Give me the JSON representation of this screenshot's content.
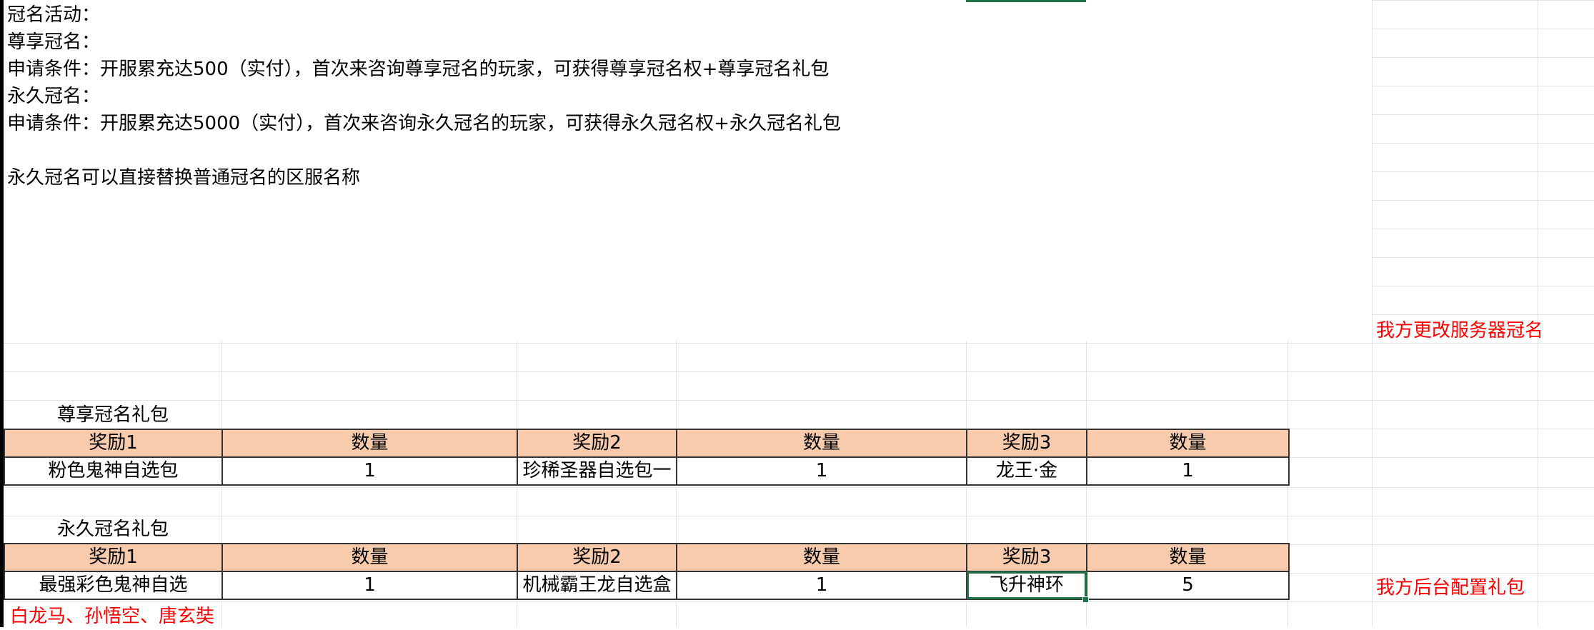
{
  "intro": {
    "line1": "冠名活动：",
    "line2": "尊享冠名：",
    "line3": "申请条件：开服累充达500（实付），首次来咨询尊享冠名的玩家，可获得尊享冠名权+尊享冠名礼包",
    "line4": "永久冠名：",
    "line5": "申请条件：开服累充达5000（实付），首次来咨询永久冠名的玩家，可获得永久冠名权+永久冠名礼包",
    "line6": "永久冠名可以直接替换普通冠名的区服名称"
  },
  "notes": {
    "rename": "我方更改服务器冠名",
    "config": "我方后台配置礼包",
    "heroes": "白龙马、孙悟空、唐玄奘"
  },
  "table1": {
    "title": "尊享冠名礼包",
    "headers": [
      "奖励1",
      "数量",
      "奖励2",
      "数量",
      "奖励3",
      "数量"
    ],
    "row": [
      "粉色鬼神自选包",
      "1",
      "珍稀圣器自选包一",
      "1",
      "龙王·金",
      "1"
    ]
  },
  "table2": {
    "title": "永久冠名礼包",
    "headers": [
      "奖励1",
      "数量",
      "奖励2",
      "数量",
      "奖励3",
      "数量"
    ],
    "row": [
      "最强彩色鬼神自选",
      "1",
      "机械霸王龙自选盒",
      "1",
      "飞升神环",
      "5"
    ]
  },
  "colors": {
    "header_fill": "#f8cbad",
    "note_red": "#ff0000",
    "selection_green": "#217346",
    "gridline": "#e2e2e2"
  }
}
